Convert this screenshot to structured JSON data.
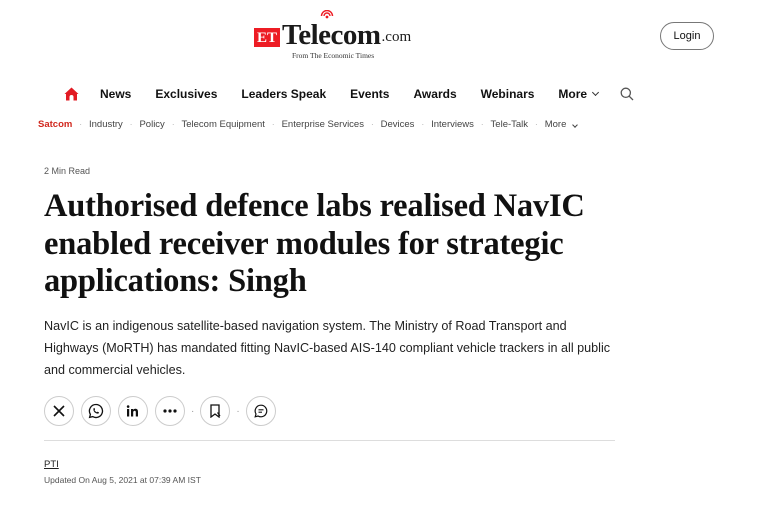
{
  "header": {
    "logo_et": "ET",
    "logo_brand": "Telecom",
    "logo_domain": ".com",
    "logo_tagline": "From The Economic Times",
    "login_label": "Login"
  },
  "main_nav": {
    "items": [
      "News",
      "Exclusives",
      "Leaders Speak",
      "Events",
      "Awards",
      "Webinars",
      "More"
    ],
    "home_icon": "home-icon",
    "search_icon": "search-icon",
    "home_icon_color": "#e21b23"
  },
  "sub_nav": {
    "items": [
      "Satcom",
      "Industry",
      "Policy",
      "Telecom Equipment",
      "Enterprise Services",
      "Devices",
      "Interviews",
      "Tele-Talk",
      "More"
    ],
    "active_color": "#d1281e"
  },
  "article": {
    "read_time": "2 Min Read",
    "headline": "Authorised defence labs realised NavIC enabled receiver modules for strategic applications: Singh",
    "summary": "NavIC is an indigenous satellite-based navigation system. The Ministry of Road Transport and Highways (MoRTH) has mandated fitting NavIC-based AIS-140 compliant vehicle trackers in all public and commercial vehicles.",
    "share_icons": [
      "x-icon",
      "whatsapp-icon",
      "linkedin-icon",
      "more-dots-icon",
      "bookmark-icon",
      "comment-icon"
    ],
    "byline": "PTI",
    "updated": "Updated On Aug 5, 2021 at 07:39 AM IST"
  }
}
